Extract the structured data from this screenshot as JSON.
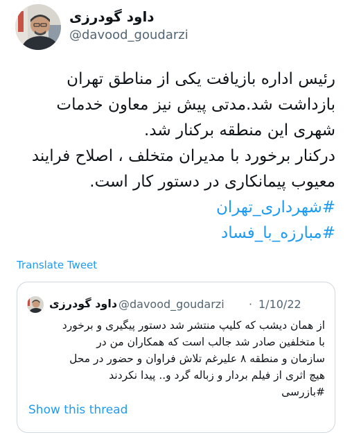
{
  "tweet": {
    "author": {
      "display_name": "داود گودرزی",
      "handle": "@davood_goudarzi"
    },
    "text_lines": [
      "رئیس اداره بازیافت یکی از مناطق تهران",
      "بازداشت شد.مدتی پیش نیز معاون خدمات",
      "شهری این منطقه برکنار شد.",
      "درکنار برخورد با مدیران متخلف ، اصلاح فرایند",
      "معیوب پیمانکاری در دستور کار است."
    ],
    "hashtags": [
      "#شهرداری_تهران",
      "#مبارزه_با_فساد"
    ],
    "translate_label": "Translate Tweet"
  },
  "quote": {
    "author": {
      "display_name": "داود گودرزی",
      "handle": "@davood_goudarzi"
    },
    "separator": "·",
    "date": "1/10/22",
    "text_lines": [
      "از همان دیشب که کلیپ منتشر شد دستور پیگیری و برخورد",
      "با متخلفین صادر شد جالب است که همکاران من در",
      "سازمان و منطقه ۸ علیرغم تلاش فراوان و حضور در محل",
      "هیچ اثری از فیلم بردار و زباله گرد و.. پیدا نکردند",
      "#بازرسی"
    ],
    "show_thread_label": "Show this thread"
  },
  "colors": {
    "link": "#1d9bf0",
    "secondary_text": "#536471",
    "border": "#cfd9de"
  }
}
